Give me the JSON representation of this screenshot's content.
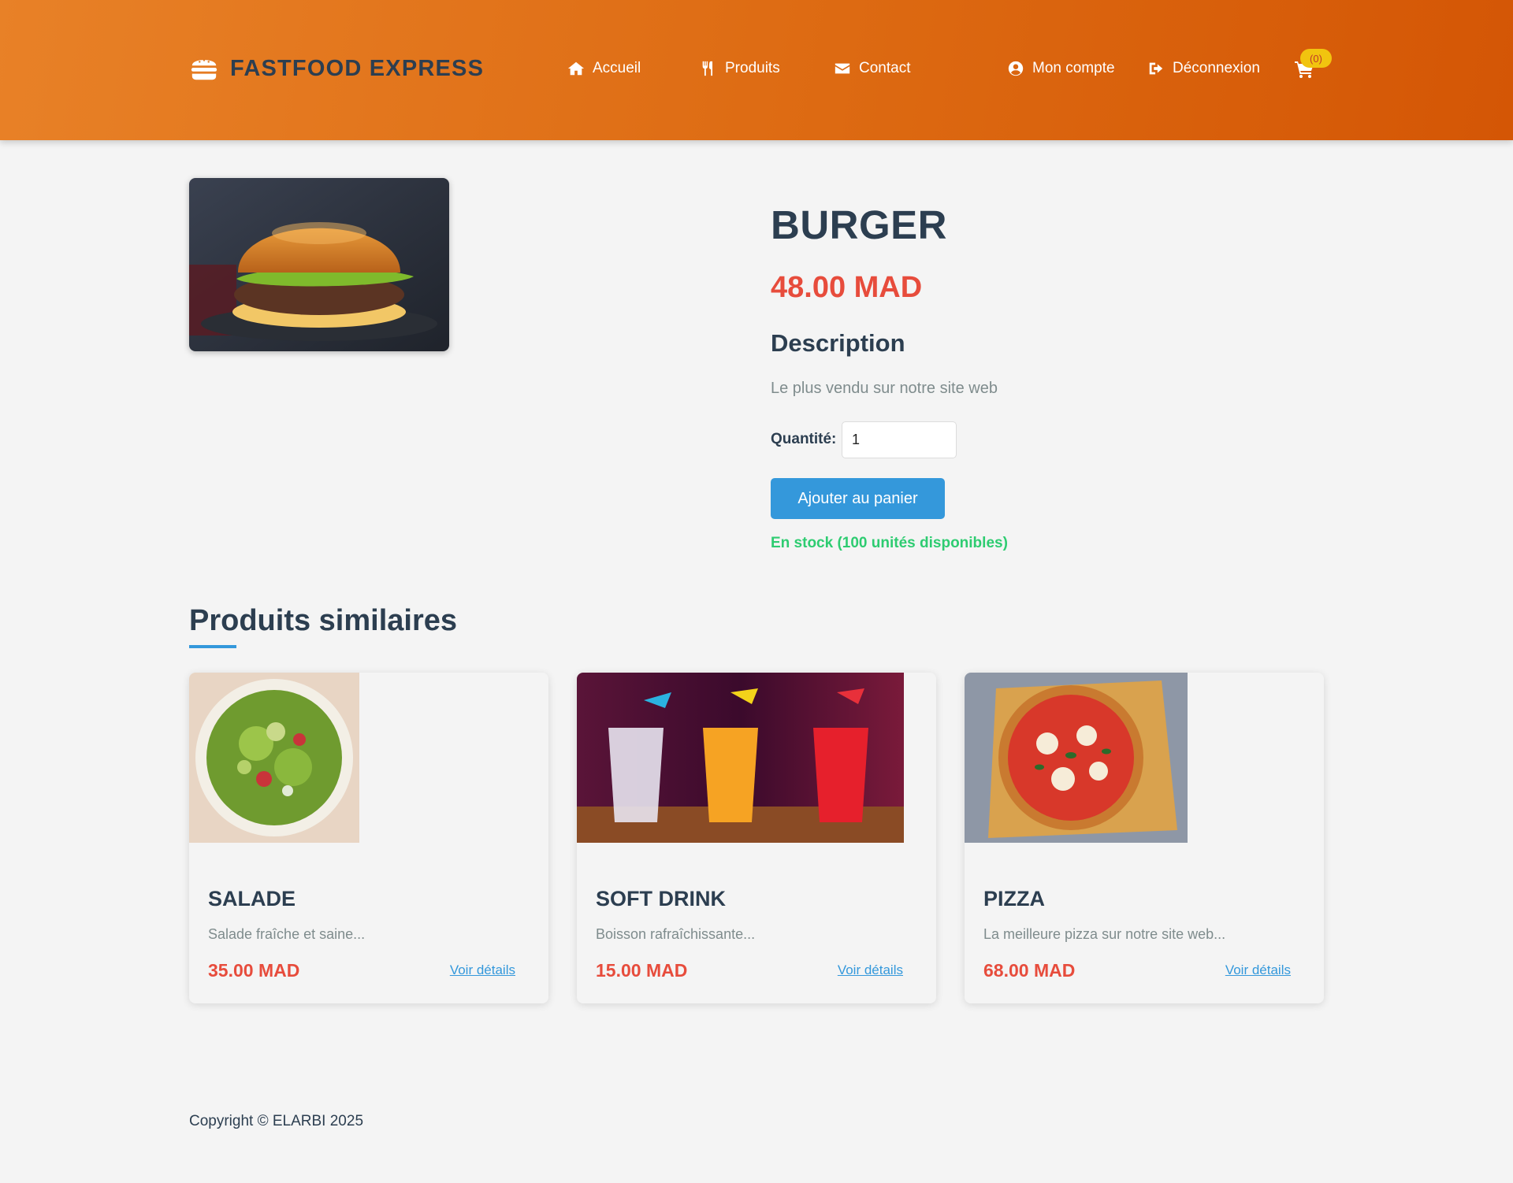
{
  "brand": {
    "name": "FASTFOOD EXPRESS",
    "icon": "burger-icon"
  },
  "nav": {
    "home": {
      "label": "Accueil",
      "icon": "home-icon"
    },
    "products": {
      "label": "Produits",
      "icon": "utensils-icon"
    },
    "contact": {
      "label": "Contact",
      "icon": "envelope-icon"
    },
    "account": {
      "label": "Mon compte",
      "icon": "user-circle-icon"
    },
    "logout": {
      "label": "Déconnexion",
      "icon": "sign-out-icon"
    },
    "cart": {
      "icon": "cart-icon",
      "badge": "(0)"
    }
  },
  "product": {
    "title": "BURGER",
    "price": "48.00 MAD",
    "description_heading": "Description",
    "description": "Le plus vendu sur notre site web",
    "quantity_label": "Quantité:",
    "quantity_value": "1",
    "add_to_cart_label": "Ajouter au panier",
    "stock_text": "En stock (100 unités disponibles)"
  },
  "similar": {
    "heading": "Produits similaires",
    "items": [
      {
        "title": "SALADE",
        "desc": "Salade fraîche et saine...",
        "price": "35.00 MAD",
        "link": "Voir détails"
      },
      {
        "title": "SOFT DRINK",
        "desc": "Boisson rafraîchissante...",
        "price": "15.00 MAD",
        "link": "Voir détails"
      },
      {
        "title": "PIZZA",
        "desc": "La meilleure pizza sur notre site web...",
        "price": "68.00 MAD",
        "link": "Voir détails"
      }
    ]
  },
  "footer": {
    "copyright": "Copyright © ELARBI 2025"
  },
  "colors": {
    "header_start": "#e88127",
    "header_end": "#d45605",
    "price": "#e74c3c",
    "accent": "#3498db",
    "stock": "#2ecc71",
    "badge": "#f1c40f",
    "text_dark": "#2c3e50"
  }
}
